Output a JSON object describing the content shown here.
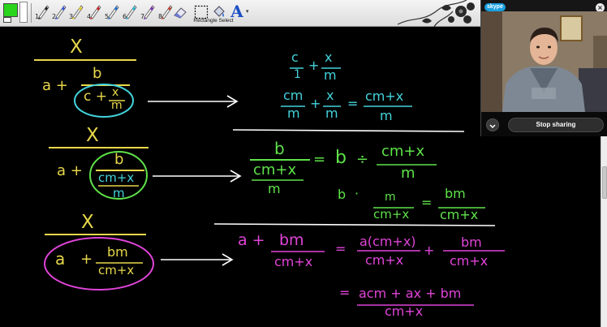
{
  "toolbar": {
    "primary_color": "#2ad41c",
    "tools": [
      {
        "num": "1",
        "icon": "pen-icon",
        "tip": "#222222"
      },
      {
        "num": "2",
        "icon": "pen-icon",
        "tip": "#3355dd"
      },
      {
        "num": "3",
        "icon": "highlighter-icon",
        "tip": "#e8d020"
      },
      {
        "num": "4",
        "icon": "pen-icon",
        "tip": "#cc2222"
      },
      {
        "num": "5",
        "icon": "pen-icon",
        "tip": "#1a6fd0"
      },
      {
        "num": "6",
        "icon": "pen-icon",
        "tip": "#27b6d8"
      },
      {
        "num": "7",
        "icon": "pen-icon",
        "tip": "#7a2bb8"
      },
      {
        "num": "8",
        "icon": "pen-icon",
        "tip": "#c43c2a"
      }
    ],
    "rect_select_label": "Rectangle Select",
    "text_tool_glyph": "A"
  },
  "skype": {
    "logo": "skype",
    "close_glyph": "×",
    "stop_sharing_label": "Stop sharing"
  },
  "canvas": {
    "p1": {
      "numerator": "X",
      "denom_a": "a +",
      "inner_top": "b",
      "inner_c": "c +",
      "inner_x": "x",
      "inner_m": "m"
    },
    "r1": {
      "c": "c",
      "one": "1",
      "plus": "+",
      "x": "x",
      "m": "m",
      "l2_cm": "cm",
      "l2_m": "m",
      "l2_plus": "+",
      "l2_x": "x",
      "l2_m2": "m",
      "l2_eq": "=",
      "l2_num": "cm+x",
      "l2_den": "m"
    },
    "p2": {
      "numerator": "X",
      "denom_a": "a +",
      "inner_top": "b",
      "inner_num": "cm+x",
      "inner_den": "m"
    },
    "r2": {
      "b": "b",
      "cmx": "cm+x",
      "m": "m",
      "eq": "=",
      "b2": "b",
      "div": "÷",
      "num": "cm+x",
      "den": "m",
      "l2_b": "b",
      "l2_dot": "·",
      "l2_m": "m",
      "l2_cmx": "cm+x",
      "l2_eq": "=",
      "l2_num": "bm",
      "l2_den": "cm+x"
    },
    "p3": {
      "numerator": "X",
      "a": "a",
      "plus": "+",
      "num": "bm",
      "den": "cm+x"
    },
    "r3": {
      "a": "a +",
      "bm": "bm",
      "cmx": "cm+x",
      "eq": "=",
      "num1": "a(cm+x)",
      "den1": "cm+x",
      "plus": "+",
      "num2": "bm",
      "den2": "cm+x",
      "l2_eq": "=",
      "l2_num": "acm + ax + bm",
      "l2_den": "cm+x"
    }
  }
}
